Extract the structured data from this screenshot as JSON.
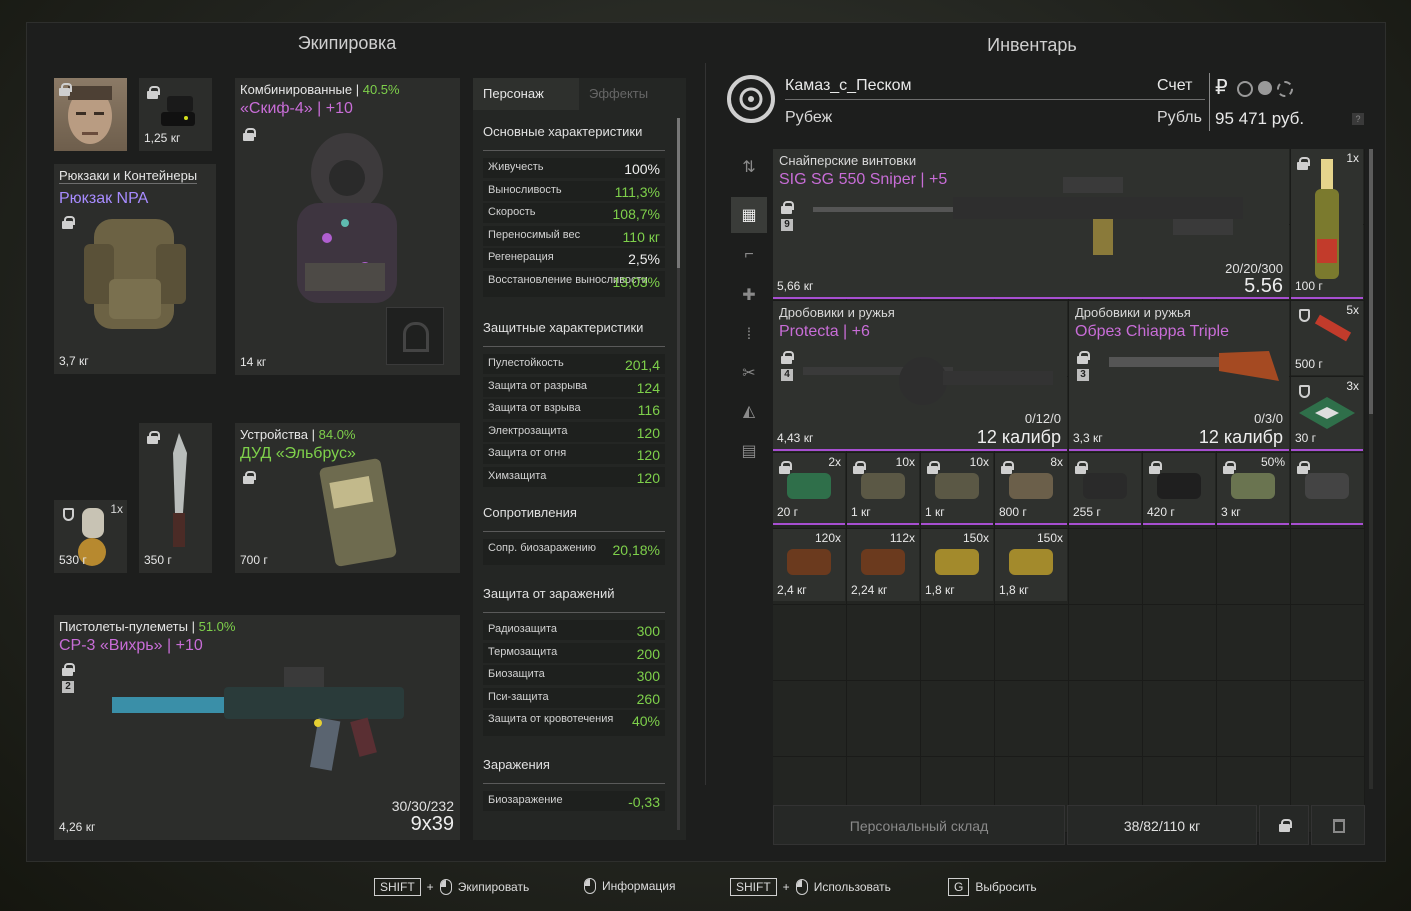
{
  "equipment": {
    "title": "Экипировка",
    "backpack": {
      "header": "Рюкзаки и Контейнеры",
      "name": "Рюкзак NPA",
      "weight": "3,7 кг"
    },
    "binoc": {
      "weight": "1,25 кг"
    },
    "armor": {
      "header": "Комбинированные",
      "durability": "40.5%",
      "name": "«Скиф-4»",
      "upgrade": "+10",
      "weight": "14 кг"
    },
    "grenade": {
      "qty": "1x",
      "price": "530 г"
    },
    "knife": {
      "price": "350 г"
    },
    "device": {
      "header": "Устройства",
      "durability": "84.0%",
      "name": "ДУД «Эльбрус»",
      "price": "700 г"
    },
    "weapon": {
      "header": "Пистолеты-пулеметы",
      "durability": "51.0%",
      "name": "СР-3 «Вихрь»",
      "upgrade": "+10",
      "badge": "2",
      "ammo": "30/30/232",
      "caliber": "9x39",
      "weight": "4,26 кг"
    }
  },
  "stats": {
    "tab_character": "Персонаж",
    "tab_effects": "Эффекты",
    "basic_title": "Основные характеристики",
    "basic": [
      {
        "label": "Живучесть",
        "value": "100%"
      },
      {
        "label": "Выносливость",
        "value": "111,3%"
      },
      {
        "label": "Скорость",
        "value": "108,7%"
      },
      {
        "label": "Переносимый вес",
        "value": "110 кг"
      },
      {
        "label": "Регенерация",
        "value": "2,5%"
      },
      {
        "label": "Восстановление выносливости",
        "value": "13,03%"
      }
    ],
    "protect_title": "Защитные характеристики",
    "protect": [
      {
        "label": "Пулестойкость",
        "value": "201,4"
      },
      {
        "label": "Защита от разрыва",
        "value": "124"
      },
      {
        "label": "Защита от взрыва",
        "value": "116"
      },
      {
        "label": "Электрозащита",
        "value": "120"
      },
      {
        "label": "Защита от огня",
        "value": "120"
      },
      {
        "label": "Химзащита",
        "value": "120"
      }
    ],
    "resist_title": "Сопротивления",
    "resist": [
      {
        "label": "Сопр. биозаражению",
        "value": "20,18%"
      }
    ],
    "infect_title": "Защита от заражений",
    "infect": [
      {
        "label": "Радиозащита",
        "value": "300"
      },
      {
        "label": "Термозащита",
        "value": "200"
      },
      {
        "label": "Биозащита",
        "value": "300"
      },
      {
        "label": "Пси-защита",
        "value": "260"
      },
      {
        "label": "Защита от кровотечения",
        "value": "40%"
      }
    ],
    "contam_title": "Заражения",
    "contam": [
      {
        "label": "Биозаражение",
        "value": "-0,33"
      }
    ]
  },
  "inventory": {
    "title": "Инвентарь",
    "player_name": "Камаз_с_Песком",
    "faction": "Рубеж",
    "account_label": "Счет",
    "currency_label": "Рубль",
    "currency_symbol": "₽",
    "balance": "95 471 руб.",
    "help": "?",
    "sniper": {
      "header": "Снайперские винтовки",
      "name": "SIG SG 550 Sniper",
      "upgrade": "+5",
      "badge": "9",
      "ammo": "20/20/300",
      "caliber": "5.56",
      "weight": "5,66 кг"
    },
    "shotgun1": {
      "header": "Дробовики и ружья",
      "name": "Protecta",
      "upgrade": "+6",
      "badge": "4",
      "ammo": "0/12/0",
      "caliber": "12 калибр",
      "weight": "4,43 кг"
    },
    "shotgun2": {
      "header": "Дробовики и ружья",
      "name": "Обрез Chiappa Triple",
      "badge": "3",
      "ammo": "0/3/0",
      "caliber": "12 калибр",
      "weight": "3,3 кг"
    },
    "side_items": [
      {
        "qty": "1x",
        "price": "100 г"
      },
      {
        "qty": "5x",
        "price": "500 г"
      },
      {
        "qty": "3x",
        "price": "30 г"
      }
    ],
    "row1": [
      {
        "qty": "2x",
        "price": "20 г"
      },
      {
        "qty": "10x",
        "price": "1 кг"
      },
      {
        "qty": "10x",
        "price": "1 кг"
      },
      {
        "qty": "8x",
        "price": "800 г"
      },
      {
        "qty": "",
        "price": "255 г"
      },
      {
        "qty": "",
        "price": "420 г"
      },
      {
        "qty": "50%",
        "price": "3 кг"
      },
      {
        "qty": "",
        "price": ""
      }
    ],
    "row2": [
      {
        "qty": "120x",
        "price": "2,4 кг"
      },
      {
        "qty": "112x",
        "price": "2,24 кг"
      },
      {
        "qty": "150x",
        "price": "1,8 кг"
      },
      {
        "qty": "150x",
        "price": "1,8 кг"
      }
    ],
    "stash_label": "Персональный склад",
    "weight_status": "38/82/110 кг"
  },
  "footer": {
    "shift1": "SHIFT",
    "equip": "Экипировать",
    "info": "Информация",
    "shift2": "SHIFT",
    "use": "Использовать",
    "g_key": "G",
    "drop": "Выбросить"
  },
  "colors": {
    "upgrade_purple": "#c86dd7",
    "stat_green": "#7ed04b"
  }
}
